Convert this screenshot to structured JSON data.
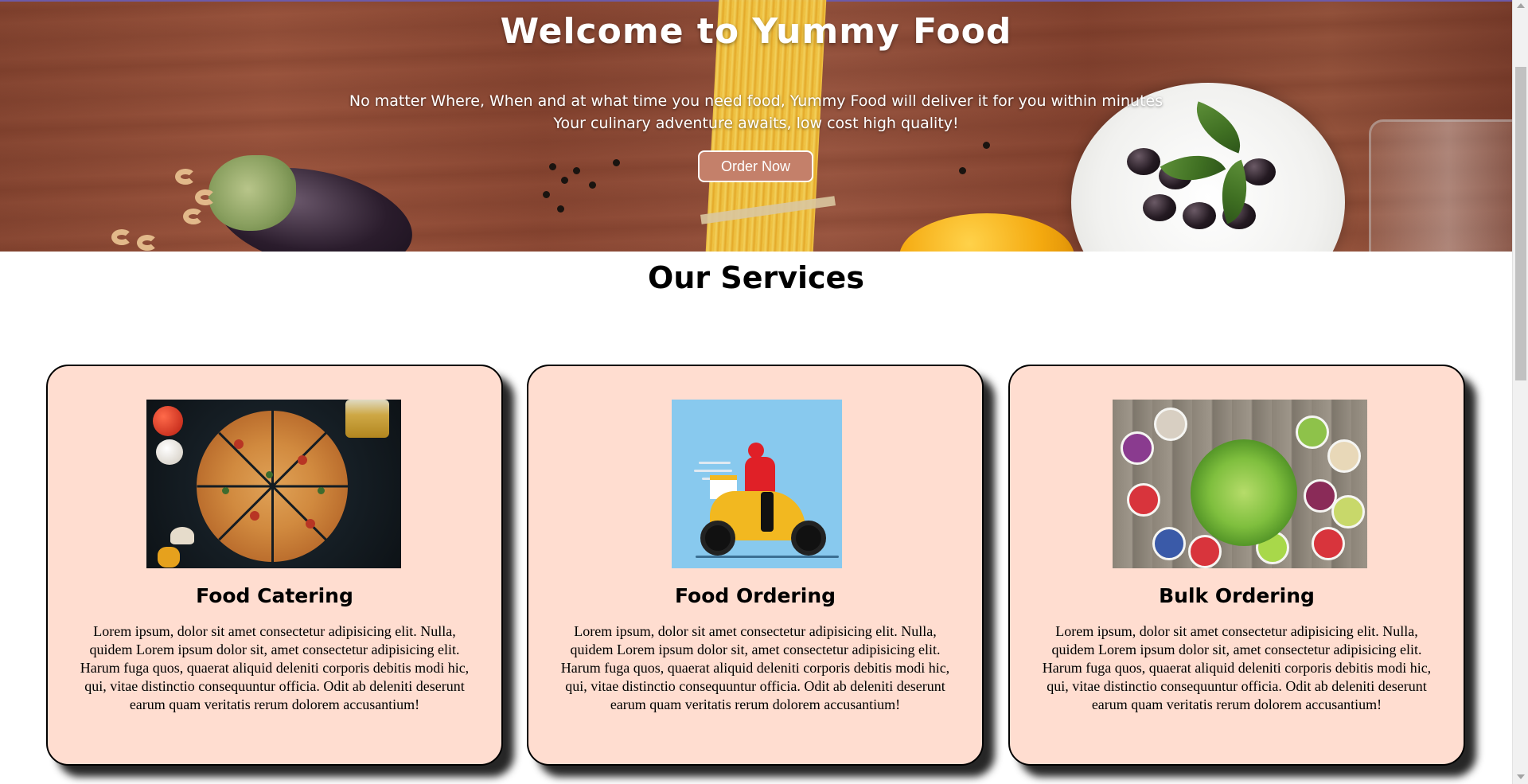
{
  "hero": {
    "title": "Welcome to Yummy Food",
    "line1": "No matter Where, When and at what time you need food, Yummy Food will deliver it for you within minutes",
    "line2": "Your culinary adventure awaits, low cost high quality!",
    "cta_label": "Order Now"
  },
  "services": {
    "heading": "Our Services",
    "cards": [
      {
        "title": "Food Catering",
        "image": "pizza-photo",
        "text": "Lorem ipsum, dolor sit amet consectetur adipisicing elit. Nulla, quidem Lorem ipsum dolor sit, amet consectetur adipisicing elit. Harum fuga quos, quaerat aliquid deleniti corporis debitis modi hic, qui, vitae distinctio consequuntur officia. Odit ab deleniti deserunt earum quam veritatis rerum dolorem accusantium!"
      },
      {
        "title": "Food Ordering",
        "image": "delivery-scooter-illustration",
        "text": "Lorem ipsum, dolor sit amet consectetur adipisicing elit. Nulla, quidem Lorem ipsum dolor sit, amet consectetur adipisicing elit. Harum fuga quos, quaerat aliquid deleniti corporis debitis modi hic, qui, vitae distinctio consequuntur officia. Odit ab deleniti deserunt earum quam veritatis rerum dolorem accusantium!"
      },
      {
        "title": "Bulk Ordering",
        "image": "salad-bowls-photo",
        "text": "Lorem ipsum, dolor sit amet consectetur adipisicing elit. Nulla, quidem Lorem ipsum dolor sit, amet consectetur adipisicing elit. Harum fuga quos, quaerat aliquid deleniti corporis debitis modi hic, qui, vitae distinctio consequuntur officia. Odit ab deleniti deserunt earum quam veritatis rerum dolorem accusantium!"
      }
    ]
  },
  "colors": {
    "card_background": "#ffddd0",
    "button_background": "#c4806a",
    "hero_text": "#ffffff"
  }
}
